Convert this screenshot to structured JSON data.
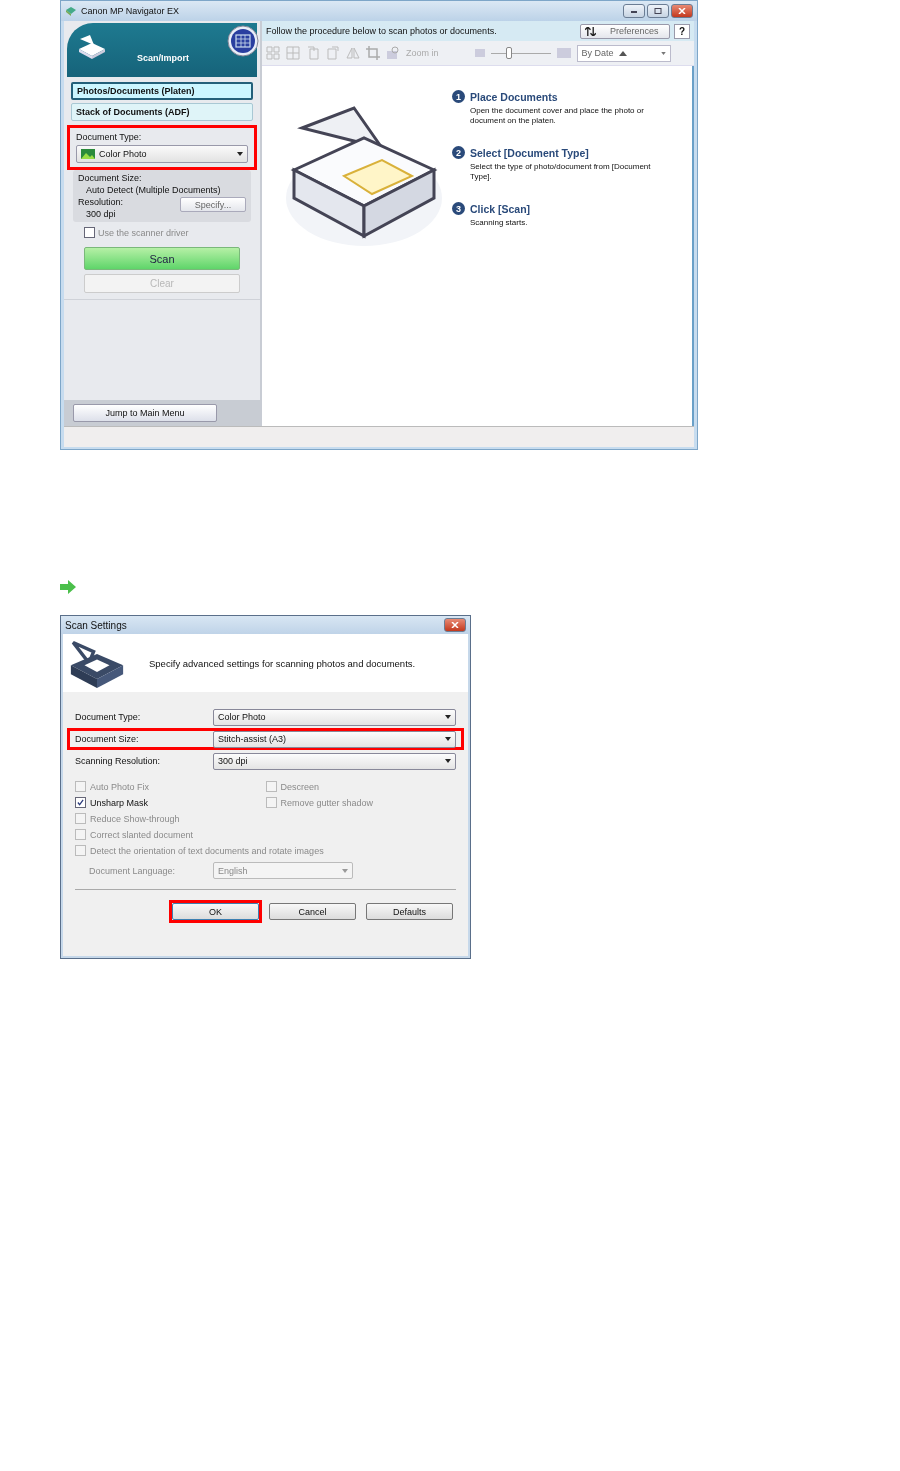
{
  "main_window": {
    "title": "Canon MP Navigator EX",
    "mode_title": "Scan/Import",
    "sources": [
      {
        "label": "Photos/Documents (Platen)",
        "selected": true
      },
      {
        "label": "Stack of Documents (ADF)",
        "selected": false
      }
    ],
    "document_type": {
      "label": "Document Type:",
      "value": "Color Photo",
      "highlighted": true
    },
    "document_size": {
      "label": "Document Size:",
      "value": "Auto Detect (Multiple Documents)"
    },
    "resolution": {
      "label": "Resolution:",
      "value": "300 dpi",
      "button": "Specify..."
    },
    "scanner_driver": {
      "label": "Use the scanner driver",
      "checked": false
    },
    "scan_button": {
      "label": "Scan",
      "disabled": false
    },
    "clear_button": {
      "label": "Clear",
      "disabled": true
    },
    "jump_button": "Jump to Main Menu",
    "instruction": "Follow the procedure below to scan photos or documents.",
    "preferences_button": "Preferences",
    "help_button": "?",
    "zoom_label": "Zoom in",
    "thumbnail_size": {
      "level": 0.3
    },
    "sort": "By Date",
    "steps": [
      {
        "number": "1",
        "title": "Place Documents",
        "text": "Open the document cover and place the photo or document on the platen."
      },
      {
        "number": "2",
        "title": "Select [Document Type]",
        "text": "Select the type of photo/document from [Document Type]."
      },
      {
        "number": "3",
        "title": "Click [Scan]",
        "text": "Scanning starts."
      }
    ]
  },
  "dialog": {
    "title": "Scan Settings",
    "description": "Specify advanced settings for scanning photos and documents.",
    "fields": [
      {
        "label": "Document Type:",
        "value": "Color Photo",
        "highlighted": false
      },
      {
        "label": "Document Size:",
        "value": "Stitch-assist (A3)",
        "highlighted": true
      },
      {
        "label": "Scanning Resolution:",
        "value": "300 dpi",
        "highlighted": false
      }
    ],
    "option_rows": [
      [
        {
          "label": "Auto Photo Fix",
          "checked": false,
          "disabled": true
        },
        {
          "label": "Descreen",
          "checked": false,
          "disabled": true
        }
      ],
      [
        {
          "label": "Unsharp Mask",
          "checked": true,
          "disabled": false
        },
        {
          "label": "Remove gutter shadow",
          "checked": false,
          "disabled": true
        }
      ],
      [
        {
          "label": "Reduce Show-through",
          "checked": false,
          "disabled": true
        }
      ],
      [
        {
          "label": "Correct slanted document",
          "checked": false,
          "disabled": true
        }
      ],
      [
        {
          "label": "Detect the orientation of text documents and rotate images",
          "checked": false,
          "disabled": true
        }
      ]
    ],
    "language": {
      "label": "Document Language:",
      "value": "English",
      "disabled": true
    },
    "buttons": [
      {
        "label": "OK",
        "highlighted": true
      },
      {
        "label": "Cancel",
        "highlighted": false
      },
      {
        "label": "Defaults",
        "highlighted": false
      }
    ]
  }
}
